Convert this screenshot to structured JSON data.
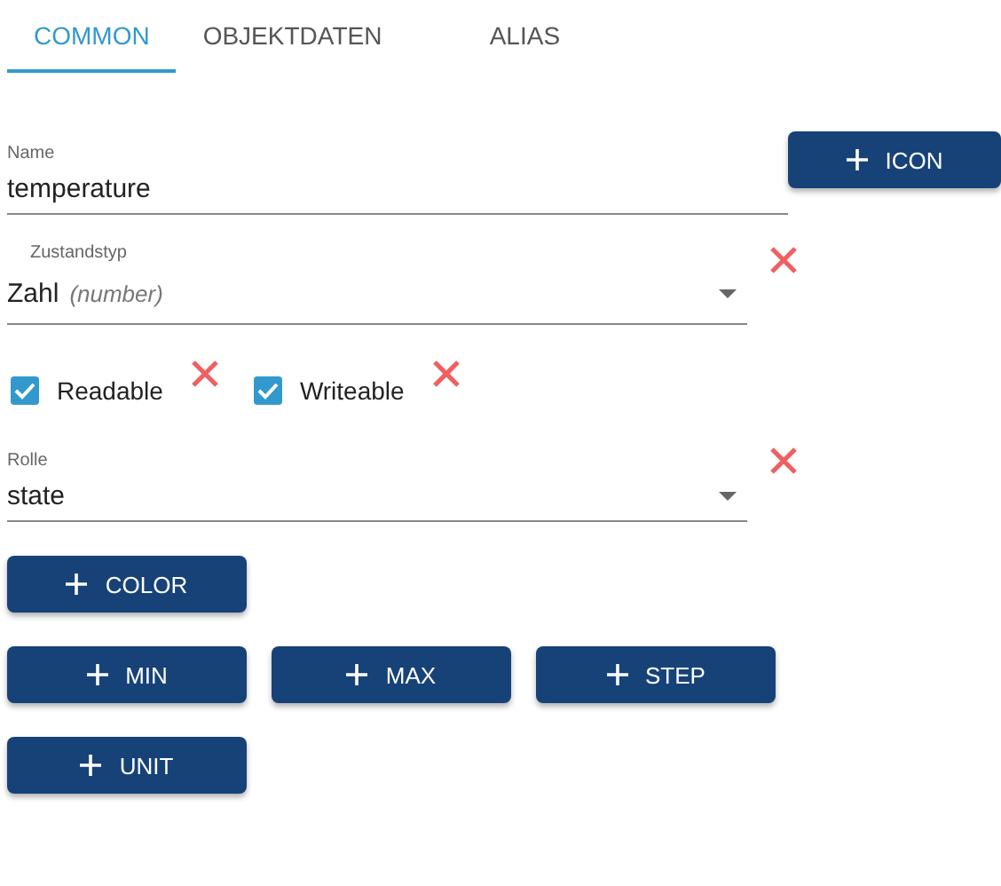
{
  "tabs": [
    {
      "label": "COMMON",
      "selected": true
    },
    {
      "label": "OBJEKTDATEN",
      "selected": false
    },
    {
      "label": "ALIAS",
      "selected": false
    }
  ],
  "name_field": {
    "label": "Name",
    "value": "temperature"
  },
  "icon_button": {
    "label": "ICON"
  },
  "state_type": {
    "label": "Zustandstyp",
    "value": "Zahl",
    "hint": "(number)"
  },
  "flags": [
    {
      "label": "Readable",
      "checked": true
    },
    {
      "label": "Writeable",
      "checked": true
    }
  ],
  "role": {
    "label": "Rolle",
    "value": "state"
  },
  "add_buttons": [
    [
      "COLOR"
    ],
    [
      "MIN",
      "MAX",
      "STEP"
    ],
    [
      "UNIT"
    ]
  ]
}
